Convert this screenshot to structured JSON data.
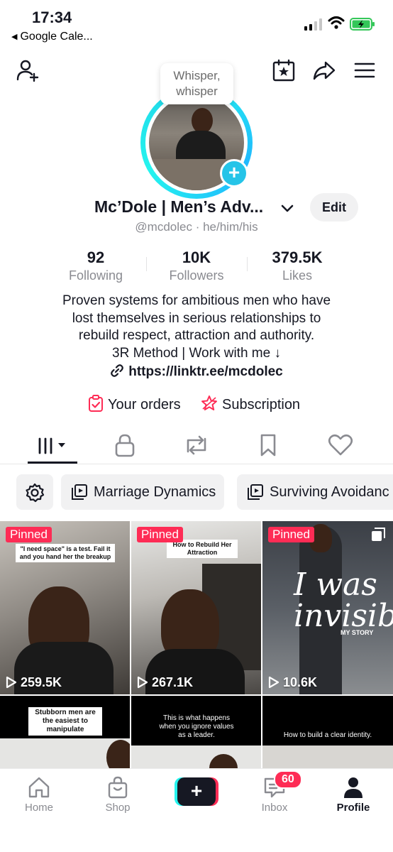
{
  "status_bar": {
    "time": "17:34",
    "back_label": "Google Cale...",
    "battery_color": "#34c759"
  },
  "header": {
    "add_user_icon": "add-user-icon",
    "calendar_icon": "calendar-star-icon",
    "share_icon": "share-icon",
    "menu_icon": "hamburger-menu-icon",
    "bubble_line1": "Whisper,",
    "bubble_line2": "whisper",
    "plus_label": "+"
  },
  "profile": {
    "name": "Mc’Dole | Men’s Adv...",
    "edit_label": "Edit",
    "handle": "@mcdolec · he/him/his",
    "stats": [
      {
        "value": "92",
        "label": "Following"
      },
      {
        "value": "10K",
        "label": "Followers"
      },
      {
        "value": "379.5K",
        "label": "Likes"
      }
    ],
    "bio": [
      "Proven systems for ambitious men who have",
      "lost themselves in serious relationships to",
      "rebuild respect, attraction and authority.",
      "3R Method | Work with me ↓"
    ],
    "link": "https://linktr.ee/mcdolec",
    "actions": {
      "orders": "Your orders",
      "subscription": "Subscription"
    }
  },
  "tabs": [
    {
      "name": "videos-grid",
      "icon": "grid-icon",
      "active": true
    },
    {
      "name": "private",
      "icon": "lock-icon",
      "active": false
    },
    {
      "name": "reposts",
      "icon": "repost-icon",
      "active": false
    },
    {
      "name": "favorites",
      "icon": "bookmark-icon",
      "active": false
    },
    {
      "name": "liked",
      "icon": "heart-icon",
      "active": false
    }
  ],
  "playlists": [
    {
      "label": "Marriage Dynamics"
    },
    {
      "label": "Surviving Avoidanc"
    }
  ],
  "videos": [
    {
      "pinned": "Pinned",
      "views": "259.5K",
      "caption": "\"I need space\" is a test. Fail it and you hand her the breakup"
    },
    {
      "pinned": "Pinned",
      "views": "267.1K",
      "caption": "How to Rebuild Her Attraction"
    },
    {
      "pinned": "Pinned",
      "views": "10.6K",
      "caption": "I was invisible",
      "caption_small": "MY STORY"
    },
    {
      "caption": "Stubborn men are the easiest to manipulate"
    },
    {
      "caption": "This is what happens when you ignore values as a leader."
    },
    {
      "caption": "How to build a clear identity."
    }
  ],
  "bottom_nav": {
    "home": "Home",
    "shop": "Shop",
    "create": "+",
    "inbox": "Inbox",
    "inbox_badge": "60",
    "profile": "Profile"
  }
}
